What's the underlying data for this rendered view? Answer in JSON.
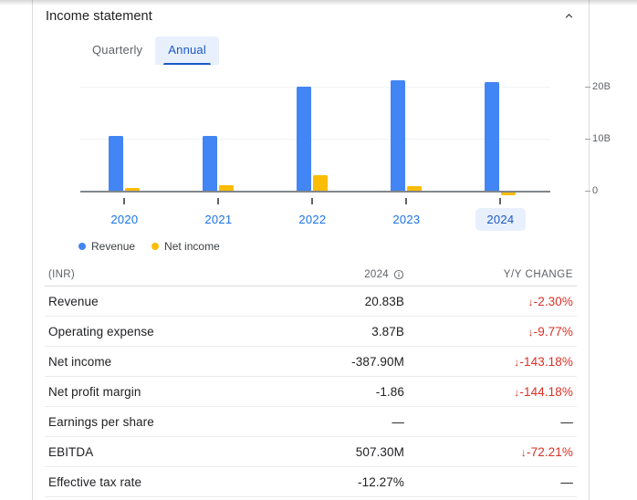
{
  "card": {
    "title": "Income statement",
    "collapse_icon": "chevron-up-icon"
  },
  "tabs": [
    {
      "label": "Quarterly",
      "active": false
    },
    {
      "label": "Annual",
      "active": true
    }
  ],
  "legend": [
    {
      "label": "Revenue",
      "color": "#4285f4",
      "icon": "legend-dot-blue"
    },
    {
      "label": "Net income",
      "color": "#fbbc04",
      "icon": "legend-dot-yellow"
    }
  ],
  "chart_data": {
    "type": "bar",
    "title": "Income statement",
    "xlabel": "",
    "ylabel": "",
    "categories": [
      "2020",
      "2021",
      "2022",
      "2023",
      "2024"
    ],
    "selected_category": "2024",
    "series": [
      {
        "name": "Revenue",
        "color": "#4285f4",
        "values": [
          10.6,
          10.5,
          20.0,
          21.3,
          20.83
        ]
      },
      {
        "name": "Net income",
        "color": "#fbbc04",
        "values": [
          0.2,
          1.1,
          3.0,
          0.9,
          -0.39
        ]
      }
    ],
    "ylim": [
      -1.5,
      23
    ],
    "yticks": [
      0,
      10,
      20
    ],
    "ytick_labels": [
      "0",
      "10B",
      "20B"
    ],
    "grid": true,
    "legend_position": "bottom-left",
    "units": "INR"
  },
  "table": {
    "header": {
      "label": "(INR)",
      "value": "2024",
      "value_info_icon": "info-icon",
      "change": "Y/Y CHANGE"
    },
    "rows": [
      {
        "label": "Revenue",
        "value": "20.83B",
        "change": "-2.30%",
        "arrow": "↓",
        "down": true
      },
      {
        "label": "Operating expense",
        "value": "3.87B",
        "change": "-9.77%",
        "arrow": "↓",
        "down": true
      },
      {
        "label": "Net income",
        "value": "-387.90M",
        "change": "-143.18%",
        "arrow": "↓",
        "down": true
      },
      {
        "label": "Net profit margin",
        "value": "-1.86",
        "change": "-144.18%",
        "arrow": "↓",
        "down": true
      },
      {
        "label": "Earnings per share",
        "value": "—",
        "change": "—",
        "arrow": "",
        "down": false
      },
      {
        "label": "EBITDA",
        "value": "507.30M",
        "change": "-72.21%",
        "arrow": "↓",
        "down": true
      },
      {
        "label": "Effective tax rate",
        "value": "-12.27%",
        "change": "—",
        "arrow": "",
        "down": false
      }
    ]
  }
}
